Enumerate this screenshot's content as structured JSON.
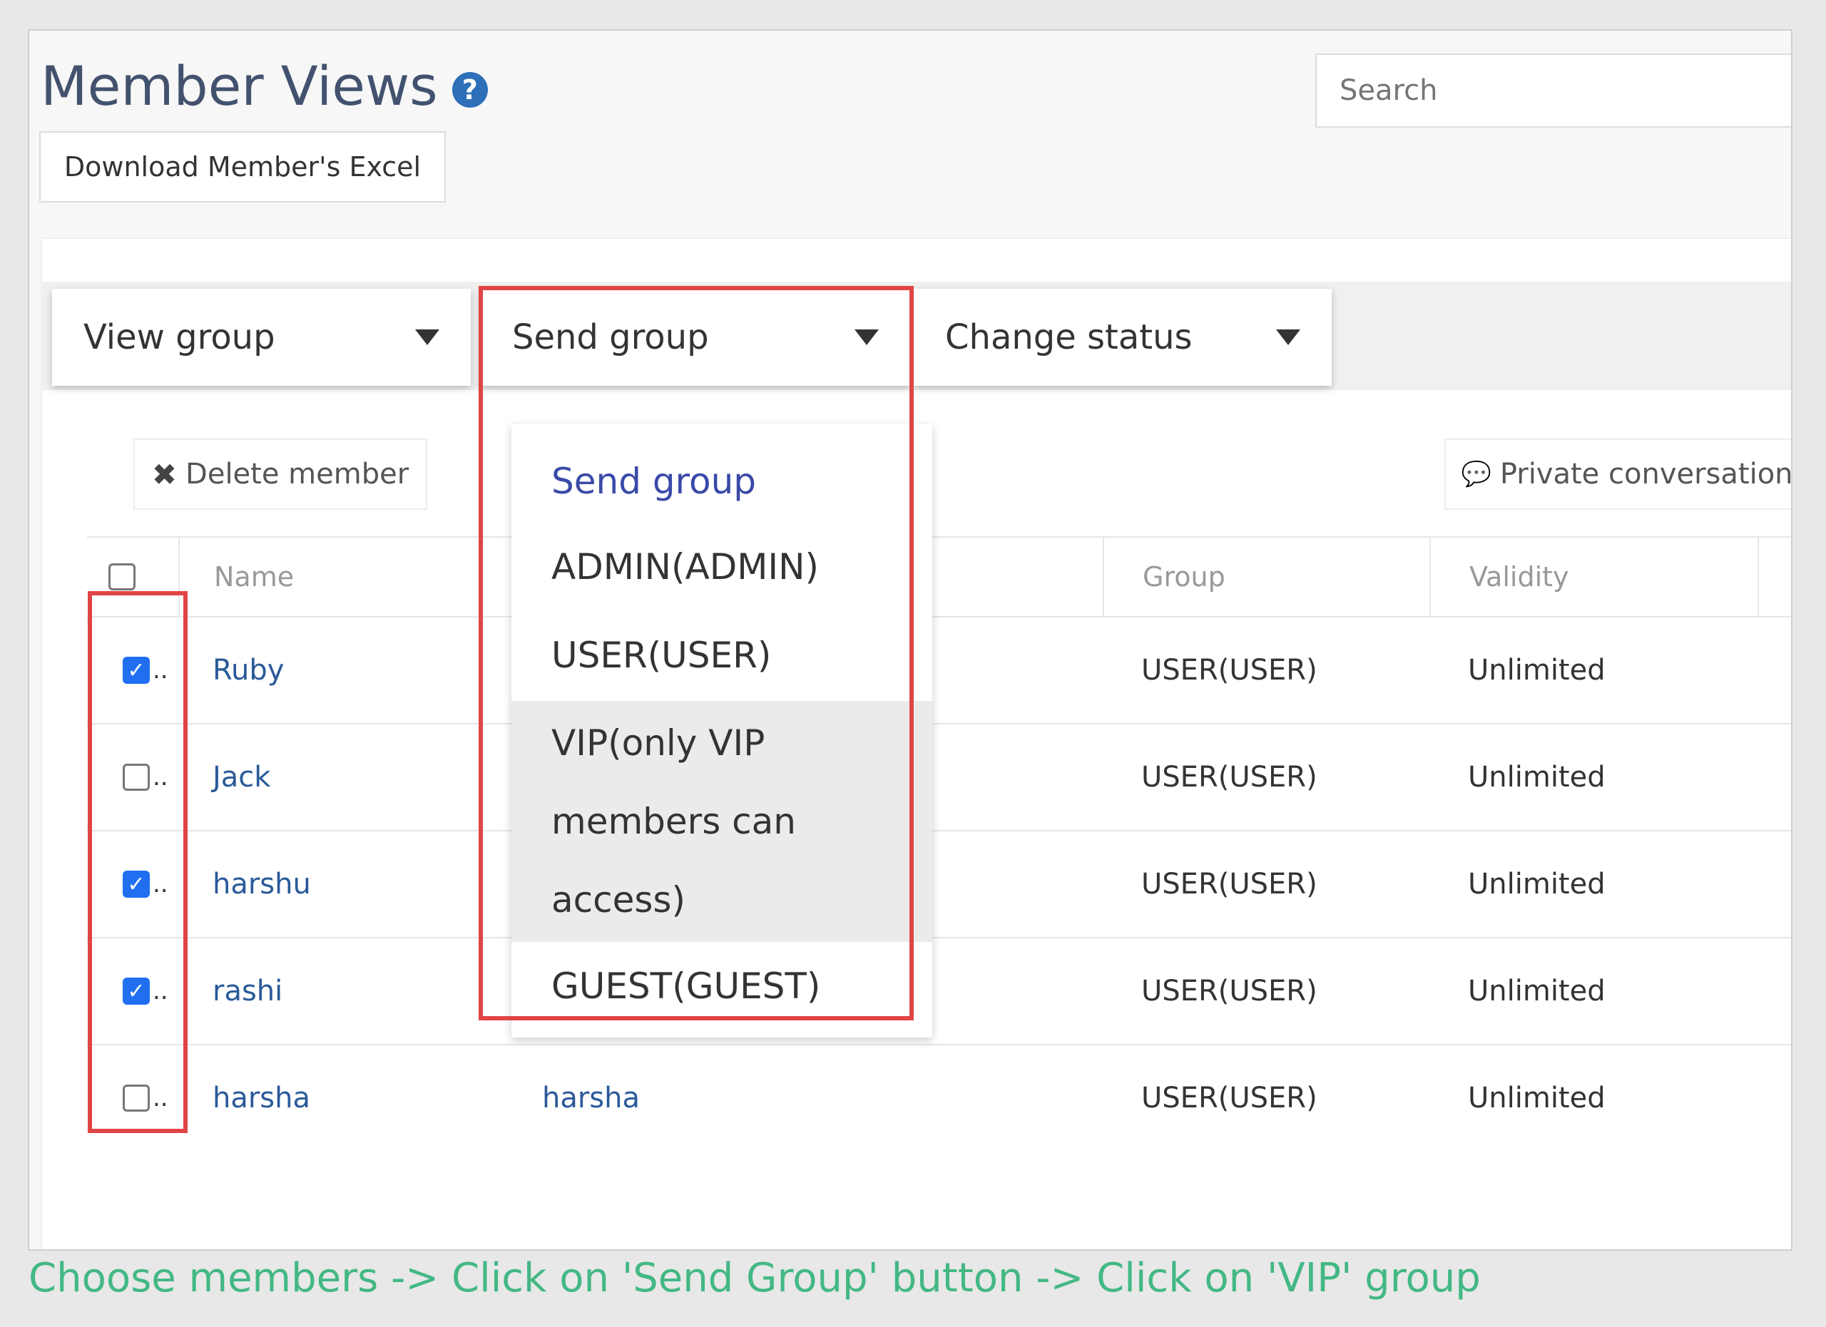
{
  "header": {
    "title": "Member Views",
    "help_icon": "?",
    "search_placeholder": "Search",
    "download_label": "Download Member's Excel"
  },
  "toolbar": {
    "view_group": "View group",
    "send_group": "Send group",
    "change_status": "Change status",
    "delete_label": "Delete member",
    "private_label": "Private conversation"
  },
  "table": {
    "columns": [
      "Name",
      "Group",
      "Validity"
    ],
    "rows": [
      {
        "checked": true,
        "name": "Ruby",
        "nickname": "",
        "group": "USER(USER)",
        "validity": "Unlimited"
      },
      {
        "checked": false,
        "name": "Jack",
        "nickname": "",
        "group": "USER(USER)",
        "validity": "Unlimited"
      },
      {
        "checked": true,
        "name": "harshu",
        "nickname": "",
        "group": "USER(USER)",
        "validity": "Unlimited"
      },
      {
        "checked": true,
        "name": "rashi",
        "nickname": "",
        "group": "USER(USER)",
        "validity": "Unlimited"
      },
      {
        "checked": false,
        "name": "harsha",
        "nickname": "harsha",
        "group": "USER(USER)",
        "validity": "Unlimited"
      }
    ]
  },
  "send_group_menu": {
    "items": [
      "Send group",
      "ADMIN(ADMIN)",
      "USER(USER)",
      "VIP(only VIP members can access)",
      "GUEST(GUEST)"
    ],
    "vip_lines": [
      "VIP(only VIP",
      "members can",
      "access)"
    ],
    "hovered": "VIP(only VIP members can access)"
  },
  "caption": "Choose members -> Click on 'Send Group' button -> Click on 'VIP' group",
  "colors": {
    "highlight": "#e04545",
    "caption": "#43b884",
    "link": "#2a5a99",
    "checkbox": "#1f6ff0"
  }
}
